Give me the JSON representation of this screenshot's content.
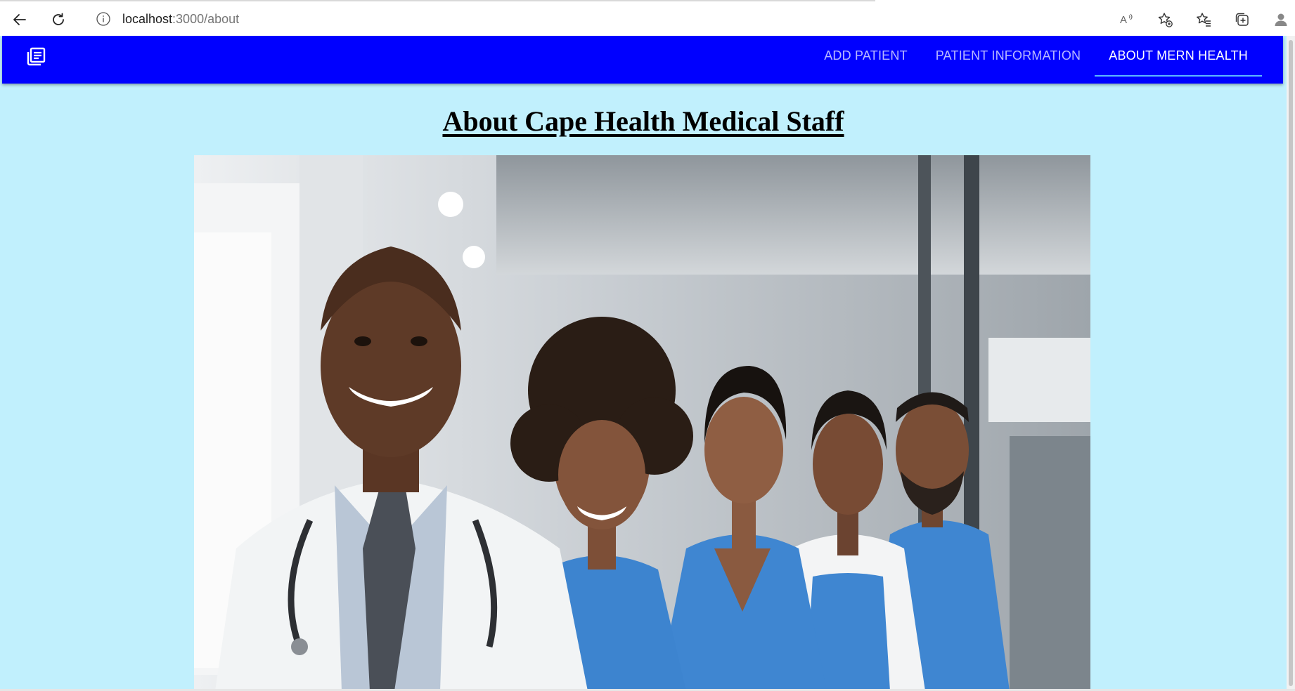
{
  "browser": {
    "url_host": "localhost",
    "url_path": ":3000/about",
    "icons": [
      "back-arrow-icon",
      "reload-icon",
      "site-info-icon",
      "read-aloud-icon",
      "add-favorite-icon",
      "favorites-icon",
      "collections-icon",
      "profile-icon"
    ]
  },
  "app": {
    "logo_icon": "notes-icon",
    "nav": {
      "add_patient": "ADD PATIENT",
      "patient_information": "PATIENT INFORMATION",
      "about": "ABOUT MERN HEALTH"
    },
    "colors": {
      "appbar": "#0000ff",
      "page_background": "#c1f0fd",
      "active_indicator": "#5cb8ff"
    }
  },
  "page": {
    "title": "About Cape Health Medical Staff",
    "hero_image": "photo of smiling medical staff in white coats and blue scrubs"
  }
}
